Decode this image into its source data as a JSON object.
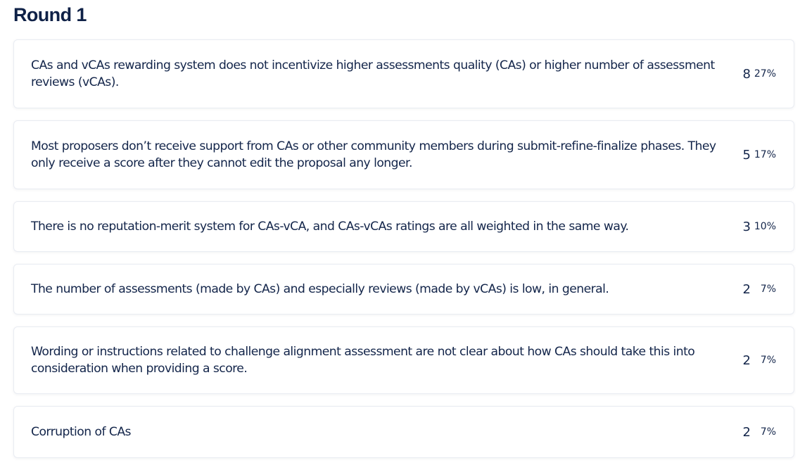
{
  "header": {
    "title": "Round 1"
  },
  "results": [
    {
      "text": "CAs and vCAs rewarding system does not incentivize higher assessments quality (CAs) or higher number of assessment reviews (vCAs).",
      "count": "8",
      "percent": "27%"
    },
    {
      "text": "Most proposers don’t receive support from CAs or other community members during submit-refine-finalize phases. They only receive a score after they cannot edit the proposal any longer.",
      "count": "5",
      "percent": "17%"
    },
    {
      "text": "There is no reputation-merit system for CAs-vCA, and CAs-vCAs ratings are all weighted in the same way.",
      "count": "3",
      "percent": "10%"
    },
    {
      "text": "The number of assessments (made by CAs) and especially reviews (made by vCAs) is low, in general.",
      "count": "2",
      "percent": "7%"
    },
    {
      "text": "Wording or instructions related to challenge alignment assessment are not clear about how CAs should take this into consideration when providing a score.",
      "count": "2",
      "percent": "7%"
    },
    {
      "text": "Corruption of CAs",
      "count": "2",
      "percent": "7%"
    }
  ]
}
